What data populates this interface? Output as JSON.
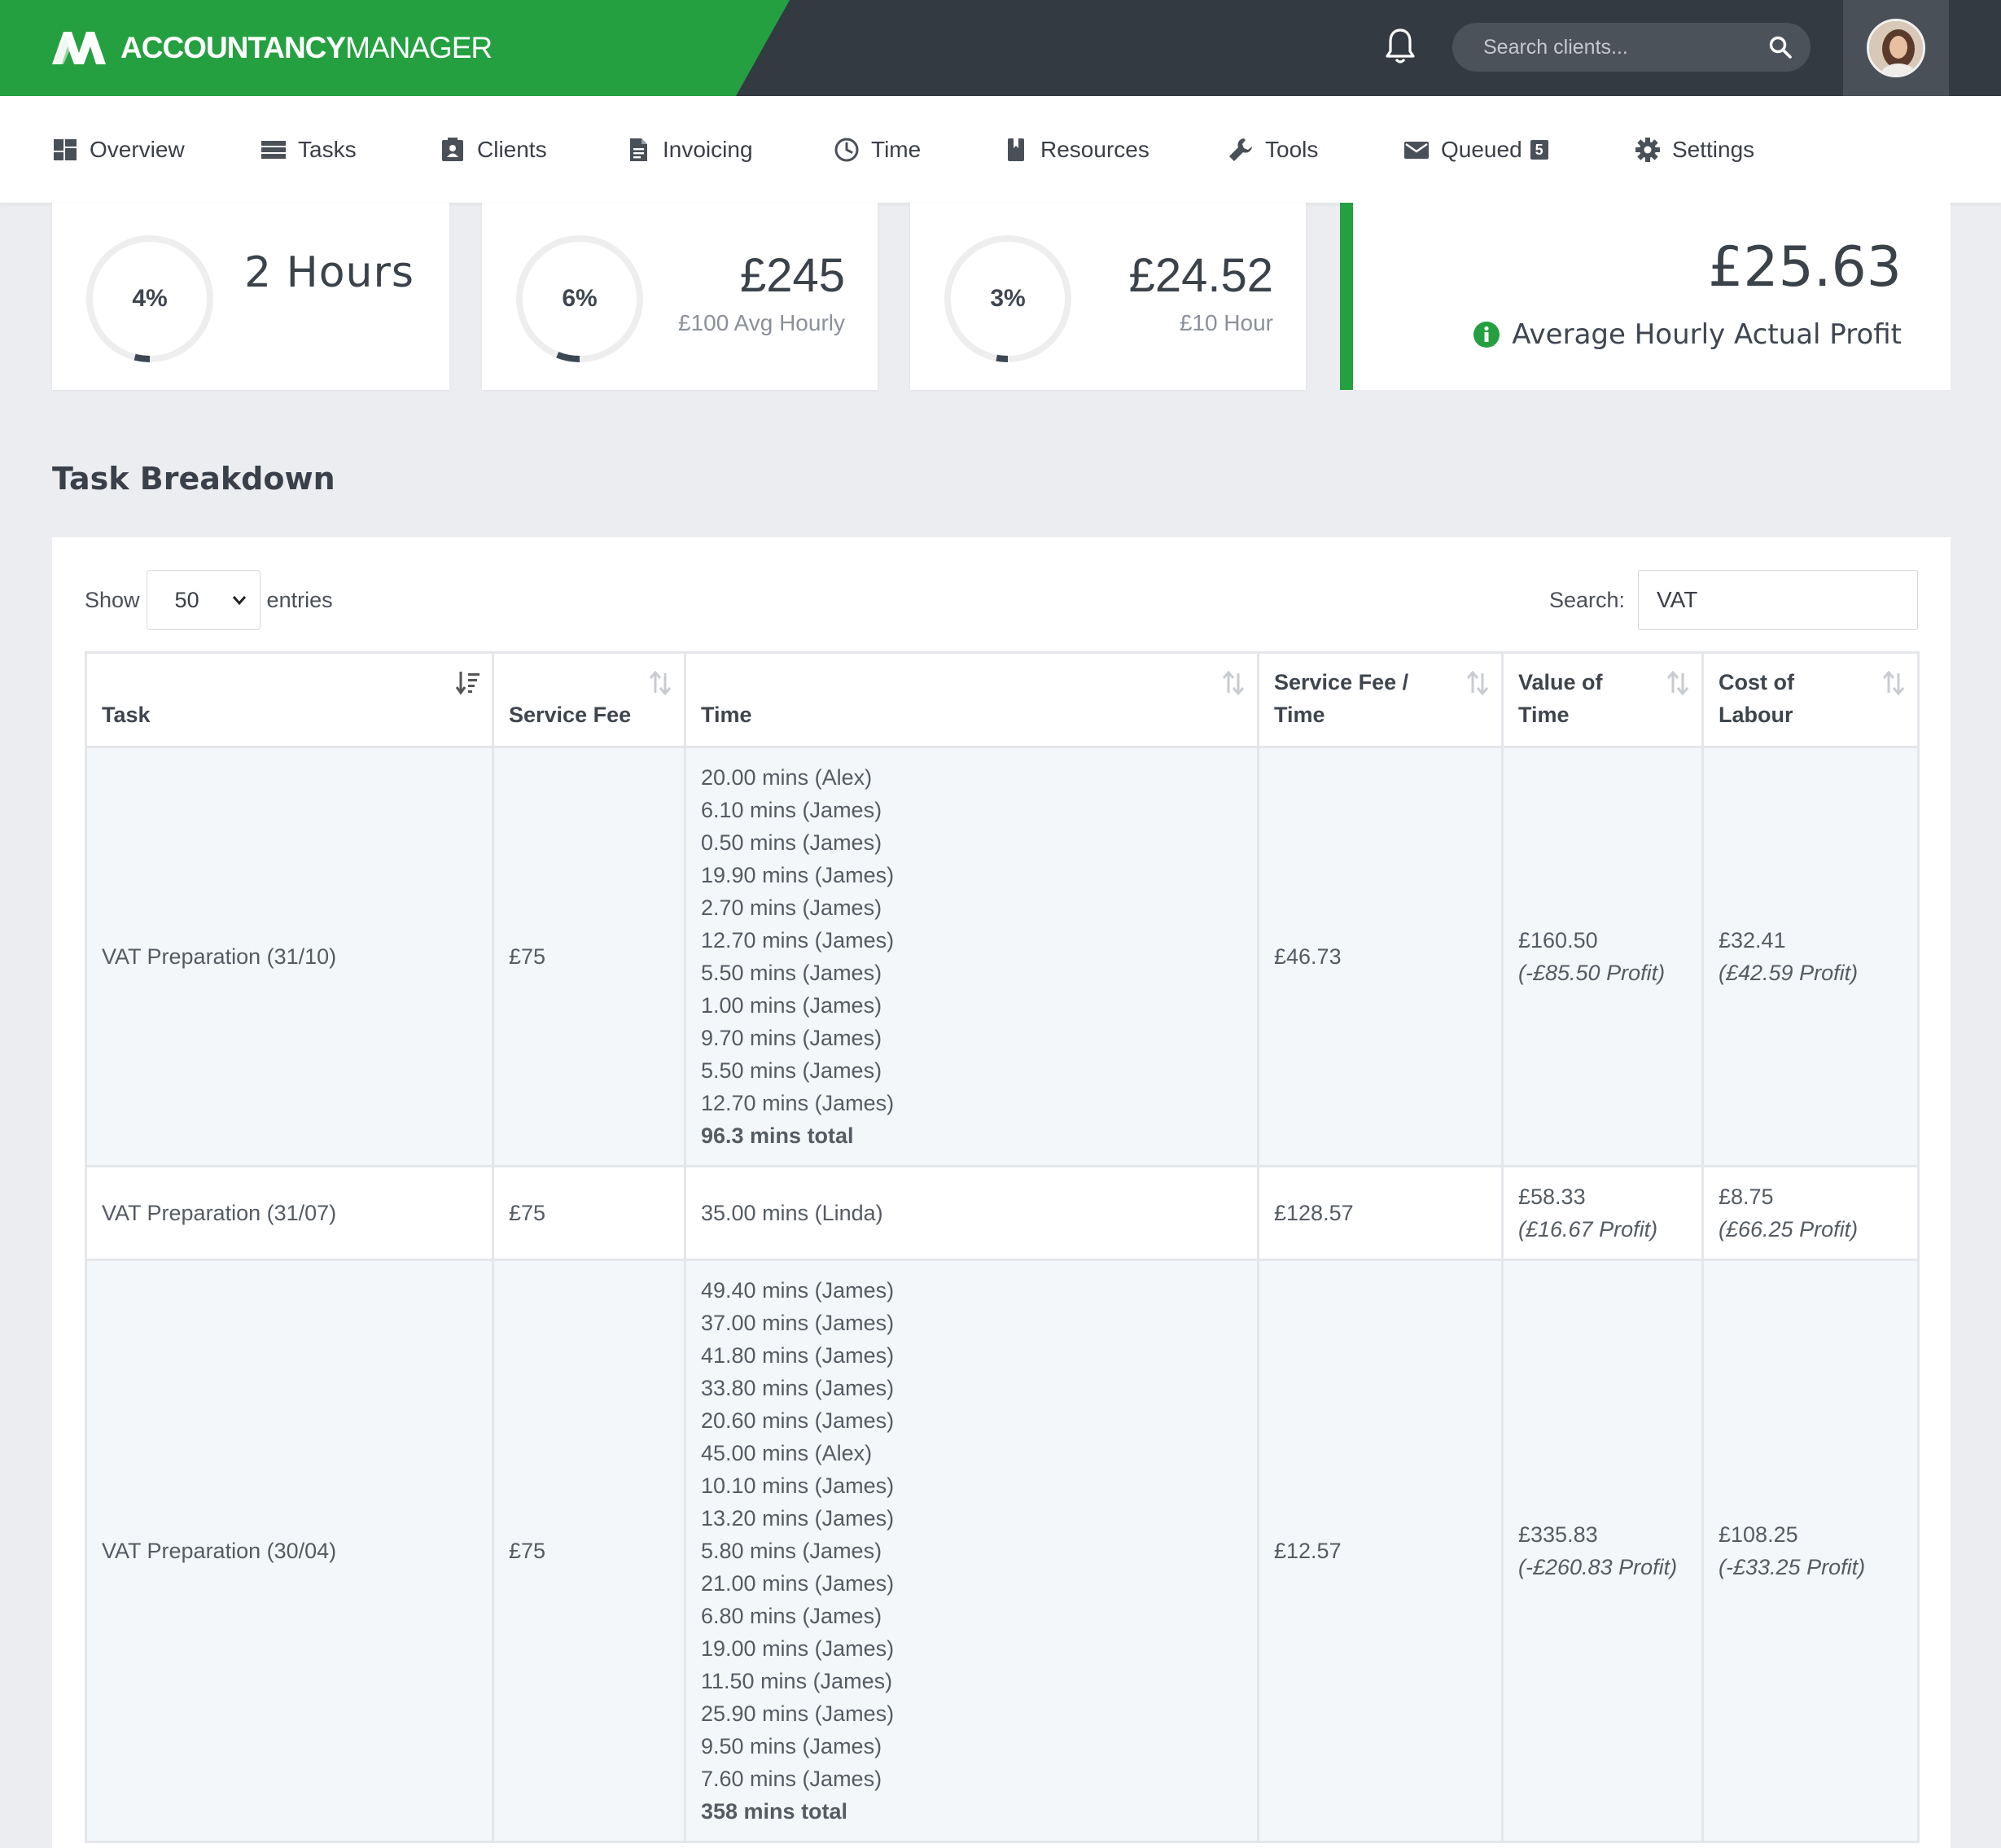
{
  "header": {
    "brand_bold": "ACCOUNTANCY",
    "brand_light": "MANAGER",
    "search_placeholder": "Search clients...",
    "icons": [
      "logo-icon",
      "bell-icon",
      "search-icon",
      "avatar"
    ]
  },
  "nav": {
    "items": [
      {
        "label": "Overview",
        "icon": "dashboard-icon"
      },
      {
        "label": "Tasks",
        "icon": "tasks-icon"
      },
      {
        "label": "Clients",
        "icon": "contact-card-icon"
      },
      {
        "label": "Invoicing",
        "icon": "document-icon"
      },
      {
        "label": "Time",
        "icon": "clock-icon"
      },
      {
        "label": "Resources",
        "icon": "book-icon"
      },
      {
        "label": "Tools",
        "icon": "wrench-icon"
      },
      {
        "label": "Queued",
        "icon": "envelope-icon",
        "badge": "5"
      },
      {
        "label": "Settings",
        "icon": "gear-icon"
      }
    ]
  },
  "stats": {
    "hours": {
      "percent": "4%",
      "value": "2 Hours",
      "fraction": 0.04
    },
    "fee": {
      "percent": "6%",
      "value": "£245",
      "sub": "£100 Avg Hourly",
      "fraction": 0.06
    },
    "cost": {
      "percent": "3%",
      "value": "£24.52",
      "sub": "£10 Hour",
      "fraction": 0.03
    },
    "profit": {
      "value": "£25.63",
      "label": "Average Hourly Actual Profit"
    }
  },
  "breakdown": {
    "title": "Task Breakdown",
    "show_label": "Show",
    "entries_value": "50",
    "entries_label": "entries",
    "search_label": "Search:",
    "search_value": "VAT",
    "columns": [
      "Task",
      "Service Fee",
      "Time",
      "Service Fee / Time",
      "Value of Time",
      "Cost of Labour"
    ],
    "rows": [
      {
        "task": "VAT Preparation (31/10)",
        "fee": "£75",
        "times": [
          "20.00 mins (Alex)",
          "6.10 mins (James)",
          "0.50 mins (James)",
          "19.90 mins (James)",
          "2.70 mins (James)",
          "12.70 mins (James)",
          "5.50 mins (James)",
          "1.00 mins (James)",
          "9.70 mins (James)",
          "5.50 mins (James)",
          "12.70 mins (James)"
        ],
        "total": "96.3 mins total",
        "fee_per_time": "£46.73",
        "value_of_time": "£160.50",
        "value_profit": "(-£85.50 Profit)",
        "cost_of_labour": "£32.41",
        "cost_profit": "(£42.59 Profit)"
      },
      {
        "task": "VAT Preparation (31/07)",
        "fee": "£75",
        "times": [
          "35.00 mins (Linda)"
        ],
        "total": "",
        "fee_per_time": "£128.57",
        "value_of_time": "£58.33",
        "value_profit": "(£16.67 Profit)",
        "cost_of_labour": "£8.75",
        "cost_profit": "(£66.25 Profit)"
      },
      {
        "task": "VAT Preparation (30/04)",
        "fee": "£75",
        "times": [
          "49.40 mins (James)",
          "37.00 mins (James)",
          "41.80 mins (James)",
          "33.80 mins (James)",
          "20.60 mins (James)",
          "45.00 mins (Alex)",
          "10.10 mins (James)",
          "13.20 mins (James)",
          "5.80 mins (James)",
          "21.00 mins (James)",
          "6.80 mins (James)",
          "19.00 mins (James)",
          "11.50 mins (James)",
          "25.90 mins (James)",
          "9.50 mins (James)",
          "7.60 mins (James)"
        ],
        "total": "358 mins total",
        "fee_per_time": "£12.57",
        "value_of_time": "£335.83",
        "value_profit": "(-£260.83 Profit)",
        "cost_of_labour": "£108.25",
        "cost_profit": "(-£33.25 Profit)"
      }
    ]
  },
  "colors": {
    "brand_green": "#24a040",
    "header_dark": "#343a41",
    "ring_track": "#eeeeee",
    "ring_fill": "#3d4753"
  }
}
